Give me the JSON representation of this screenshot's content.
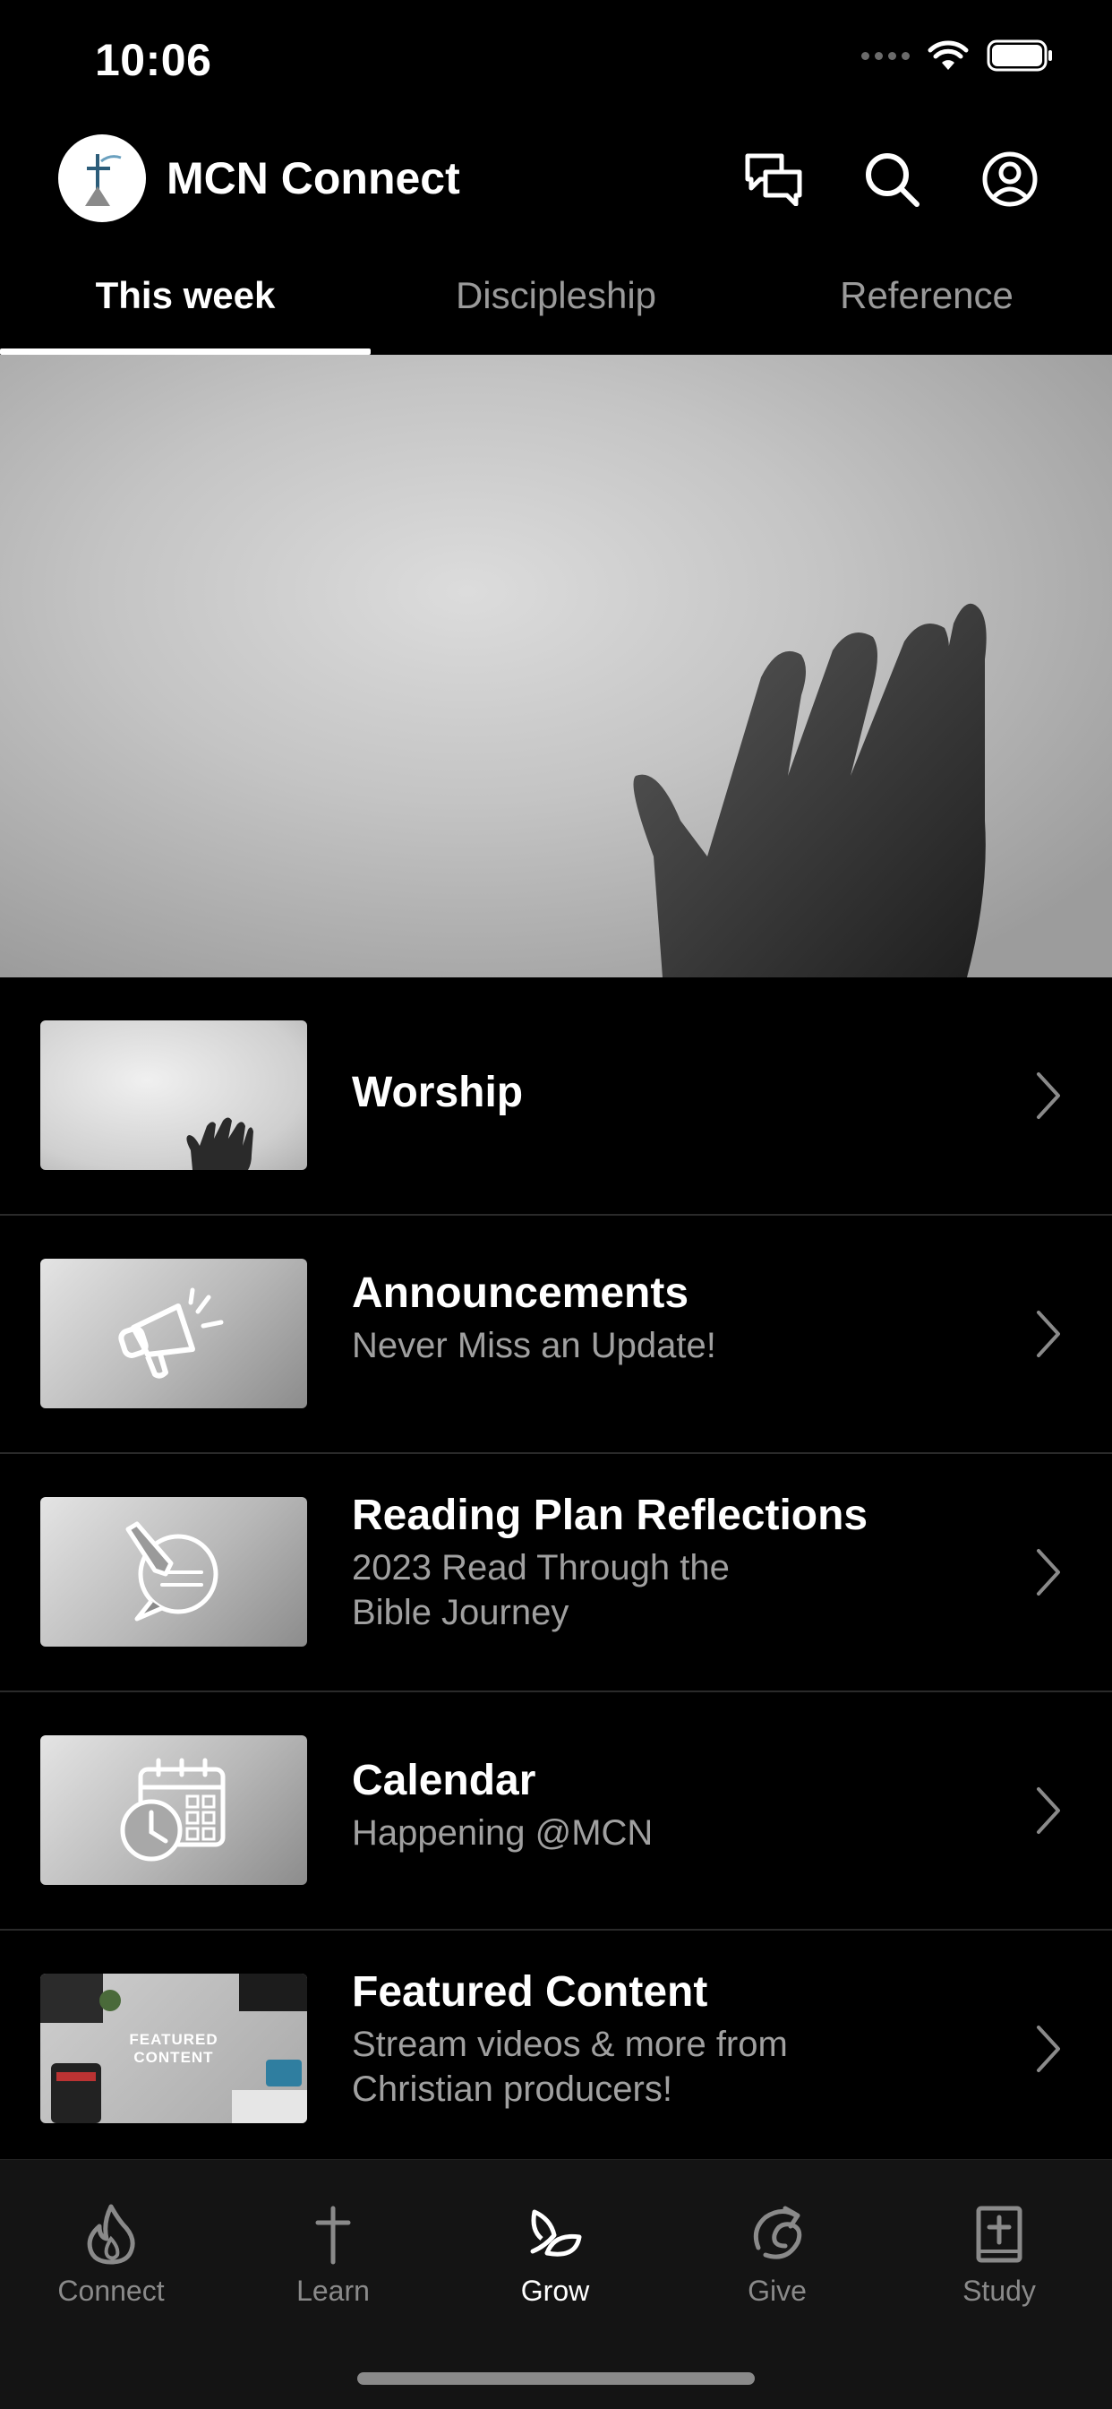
{
  "status_bar": {
    "time": "10:06"
  },
  "header": {
    "app_title": "MCN Connect"
  },
  "tabs": [
    {
      "label": "This week",
      "active": true
    },
    {
      "label": "Discipleship",
      "active": false
    },
    {
      "label": "Reference",
      "active": false
    }
  ],
  "list": [
    {
      "title": "Worship",
      "subtitle_lines": []
    },
    {
      "title": "Announcements",
      "subtitle_lines": [
        "Never Miss an Update!"
      ]
    },
    {
      "title": "Reading Plan Reflections",
      "subtitle_lines": [
        "2023 Read Through the",
        "Bible Journey"
      ]
    },
    {
      "title": "Calendar",
      "subtitle_lines": [
        "Happening @MCN"
      ]
    },
    {
      "title": "Featured Content",
      "subtitle_lines": [
        "Stream videos & more from",
        "Christian producers!"
      ],
      "thumb_text": [
        "FEATURED",
        "CONTENT"
      ]
    }
  ],
  "tabbar": [
    {
      "label": "Connect",
      "icon": "flame-icon",
      "active": false
    },
    {
      "label": "Learn",
      "icon": "cross-icon",
      "active": false
    },
    {
      "label": "Grow",
      "icon": "sprout-icon",
      "active": true
    },
    {
      "label": "Give",
      "icon": "give-icon",
      "active": false
    },
    {
      "label": "Study",
      "icon": "bible-icon",
      "active": false
    }
  ],
  "colors": {
    "background": "#000000",
    "tabbar_bg": "#141414",
    "muted_text": "#a0a0a0",
    "active": "#ffffff"
  }
}
